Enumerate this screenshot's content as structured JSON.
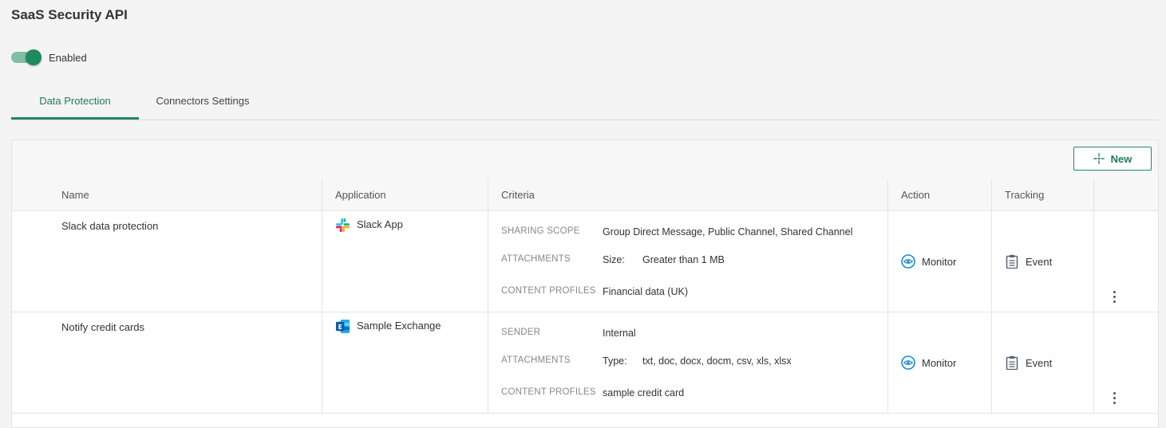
{
  "page": {
    "title": "SaaS Security API"
  },
  "toggle": {
    "label": "Enabled",
    "on": true
  },
  "tabs": [
    {
      "label": "Data Protection",
      "active": true
    },
    {
      "label": "Connectors Settings",
      "active": false
    }
  ],
  "toolbar": {
    "new_label": "New"
  },
  "table": {
    "headers": {
      "name": "Name",
      "application": "Application",
      "criteria": "Criteria",
      "action": "Action",
      "tracking": "Tracking"
    },
    "rows": [
      {
        "name": "Slack data protection",
        "application": "Slack App",
        "app_icon": "slack-icon",
        "criteria": [
          {
            "key": "SHARING SCOPE",
            "sub": "",
            "value": "Group Direct Message, Public Channel, Shared Channel"
          },
          {
            "key": "ATTACHMENTS",
            "sub": "Size:",
            "value": "Greater than 1 MB"
          },
          {
            "key": "CONTENT PROFILES",
            "sub": "",
            "value": "Financial data (UK)"
          }
        ],
        "action": "Monitor",
        "tracking": "Event"
      },
      {
        "name": "Notify credit cards",
        "application": "Sample Exchange",
        "app_icon": "exchange-icon",
        "criteria": [
          {
            "key": "SENDER",
            "sub": "",
            "value": "Internal"
          },
          {
            "key": "ATTACHMENTS",
            "sub": "Type:",
            "value": "txt, doc, docx, docm, csv, xls, xlsx"
          },
          {
            "key": "CONTENT PROFILES",
            "sub": "",
            "value": "sample credit card"
          }
        ],
        "action": "Monitor",
        "tracking": "Event"
      }
    ]
  },
  "colors": {
    "accent": "#1f8a5c",
    "monitor_icon": "#1a8ad4",
    "tracking_icon": "#5a6470"
  }
}
